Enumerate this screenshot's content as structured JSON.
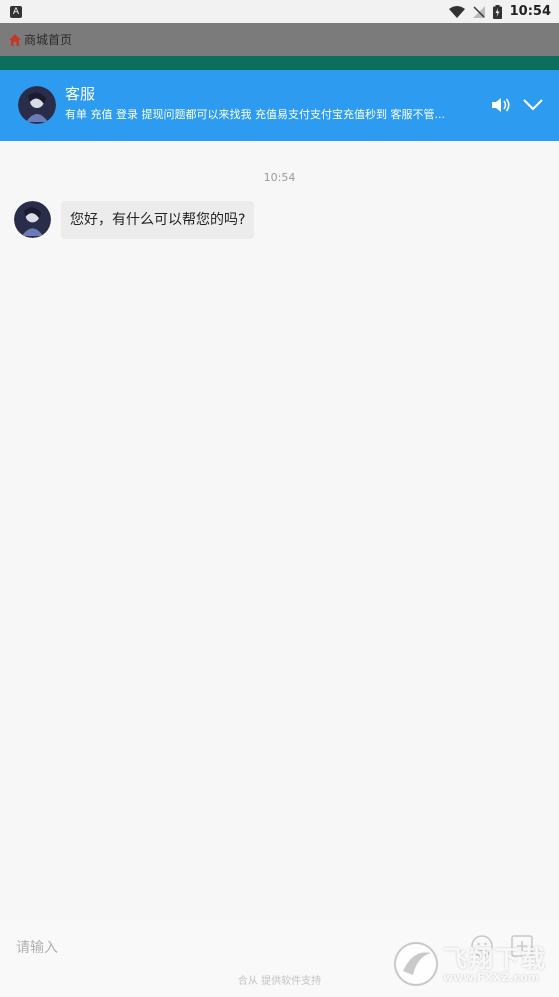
{
  "status_bar": {
    "app_indicator": "A",
    "time": "10:54"
  },
  "shop_strip": {
    "home_label": "商城首页"
  },
  "header": {
    "title": "客服",
    "notice": "有单 充值 登录 提现问题都可以来找我 充值易支付支付宝充值秒到 客服不管..."
  },
  "chat": {
    "timestamp": "10:54",
    "messages": [
      {
        "text": "您好，有什么可以帮您的吗?"
      }
    ]
  },
  "input_bar": {
    "placeholder": "请输入",
    "footer_note": "合从 提供软件支持"
  },
  "watermark": {
    "text": "飞翔下载",
    "url": "www.FXXZ.com"
  },
  "colors": {
    "header_bg": "#2d9cf0",
    "green_band": "#0b6f5c",
    "chat_bg": "#f7f7f7"
  },
  "icons": [
    "wifi-icon",
    "signal-icon",
    "battery-icon",
    "home-icon",
    "speaker-icon",
    "chevron-down-icon",
    "emoji-icon",
    "more-icon"
  ]
}
